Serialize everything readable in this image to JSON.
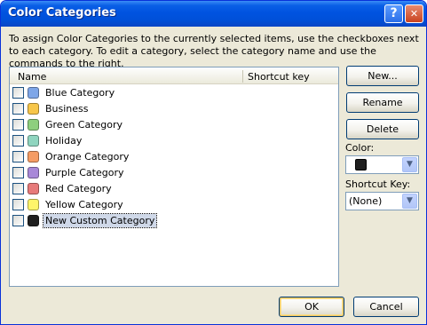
{
  "window": {
    "title": "Color Categories"
  },
  "titlebar": {
    "help_glyph": "?",
    "close_glyph": "✕"
  },
  "instructions": "To assign Color Categories to the currently selected items, use the checkboxes next to each category.  To edit a category, select the category name and use the commands to the right.",
  "list": {
    "headers": {
      "name": "Name",
      "shortcut": "Shortcut key"
    },
    "items": [
      {
        "label": "Blue Category",
        "color": "#7ea6e8",
        "checked": false,
        "selected": false
      },
      {
        "label": "Business",
        "color": "#f7c64a",
        "checked": false,
        "selected": false
      },
      {
        "label": "Green Category",
        "color": "#8ecf7e",
        "checked": false,
        "selected": false
      },
      {
        "label": "Holiday",
        "color": "#8fd5bf",
        "checked": false,
        "selected": false
      },
      {
        "label": "Orange Category",
        "color": "#f59c64",
        "checked": false,
        "selected": false
      },
      {
        "label": "Purple Category",
        "color": "#a888d8",
        "checked": false,
        "selected": false
      },
      {
        "label": "Red Category",
        "color": "#e77a7a",
        "checked": false,
        "selected": false
      },
      {
        "label": "Yellow Category",
        "color": "#fff56a",
        "checked": false,
        "selected": false
      },
      {
        "label": "New Custom Category",
        "color": "#1f1f1f",
        "checked": false,
        "selected": true
      }
    ]
  },
  "buttons": {
    "new": "New...",
    "rename": "Rename",
    "delete": "Delete",
    "ok": "OK",
    "cancel": "Cancel"
  },
  "color_field": {
    "label": "Color:",
    "value_color": "#1f1f1f"
  },
  "shortcut_field": {
    "label": "Shortcut Key:",
    "value": "(None)"
  },
  "dropdown_glyph": "▼"
}
